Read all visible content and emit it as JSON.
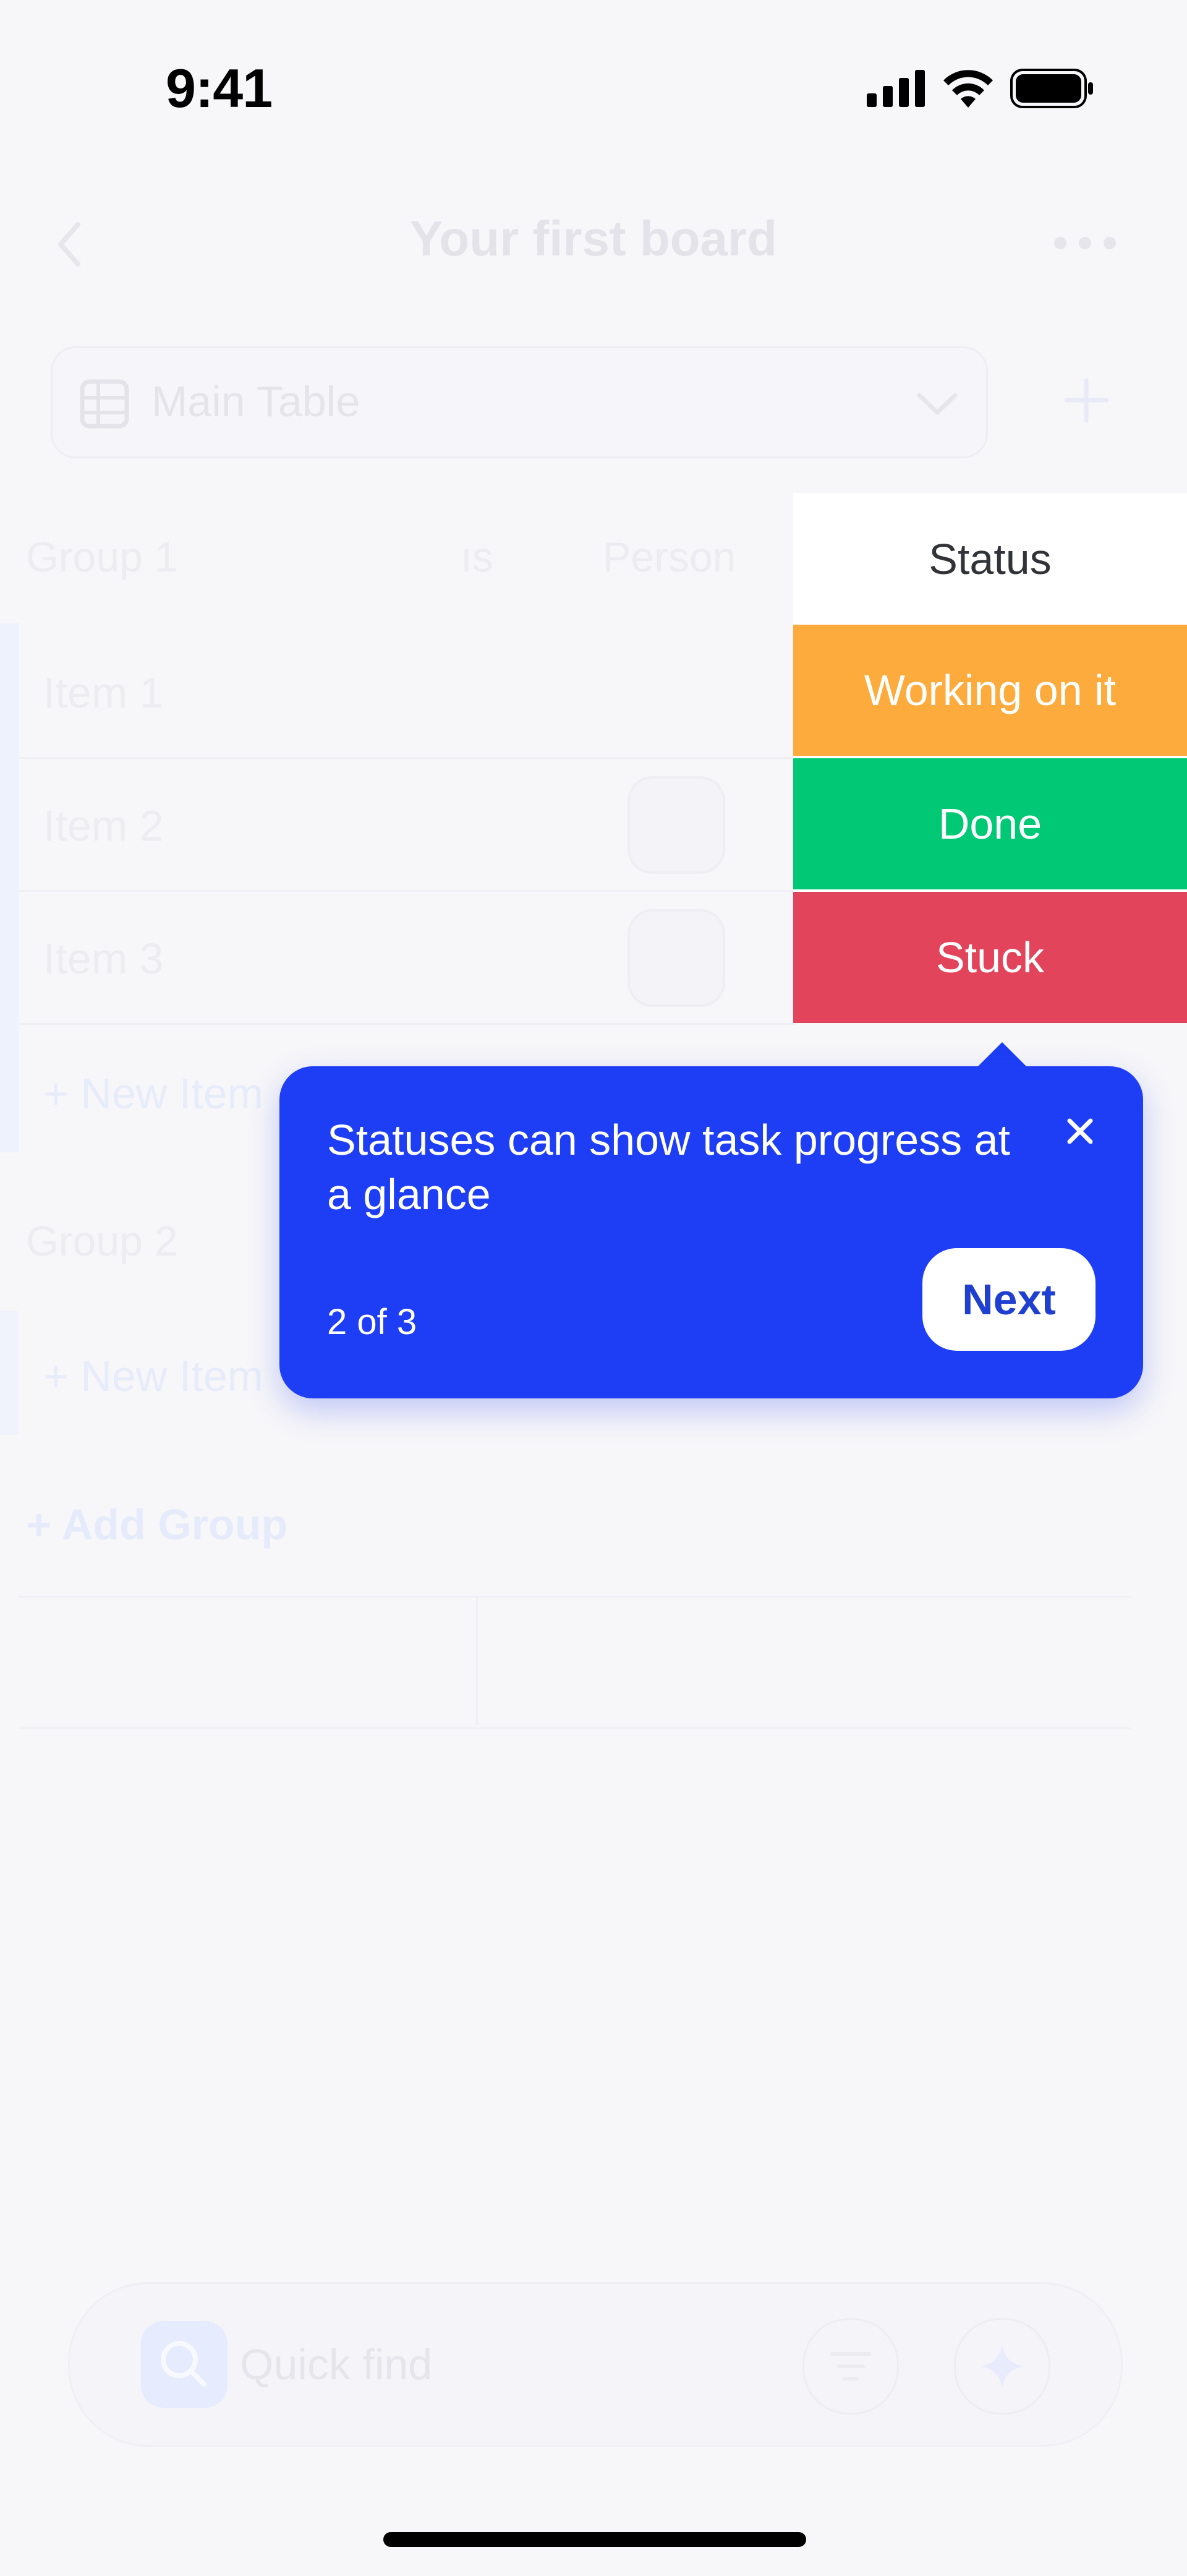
{
  "status_bar": {
    "time": "9:41"
  },
  "board": {
    "title": "Your first board",
    "view_name": "Main Table",
    "columns": {
      "group_col": "Group 1",
      "truncated_col": "ıs",
      "person_col": "Person",
      "status_col": "Status"
    },
    "group1": {
      "items": [
        "Item 1",
        "Item 2",
        "Item 3"
      ],
      "new_item": "+ New Item"
    },
    "group2": {
      "name": "Group 2",
      "new_item": "+ New Item"
    },
    "add_group": "+ Add Group"
  },
  "status_options": [
    "Working on it",
    "Done",
    "Stuck"
  ],
  "tooltip": {
    "message": "Statuses can show task progress at a glance",
    "step": "2 of 3",
    "next_label": "Next"
  },
  "bottom_bar": {
    "quick_find_placeholder": "Quick find"
  },
  "colors": {
    "accent": "#1e3ef5",
    "working_on_it": "#fdab3d",
    "done": "#00c875",
    "stuck": "#e2445c"
  },
  "icons": [
    "back-chevron-icon",
    "more-dots-icon",
    "table-icon",
    "chevron-down-icon",
    "plus-icon",
    "person-avatar-icon",
    "close-icon",
    "search-icon",
    "filter-icon",
    "ai-sparkle-icon",
    "signal-icon",
    "wifi-icon",
    "battery-icon"
  ]
}
